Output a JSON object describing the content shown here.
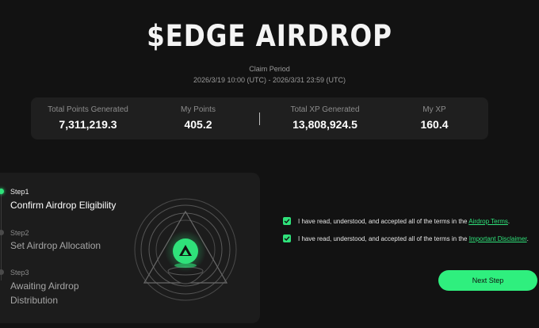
{
  "header": {
    "title": "$EDGE AIRDROP",
    "claim_label": "Claim Period",
    "claim_range": "2026/3/19 10:00 (UTC) - 2026/3/31 23:59 (UTC)"
  },
  "stats": [
    {
      "label": "Total Points Generated",
      "value": "7,311,219.3"
    },
    {
      "label": "My Points",
      "value": "405.2"
    },
    {
      "label": "Total XP Generated",
      "value": "13,808,924.5"
    },
    {
      "label": "My XP",
      "value": "160.4"
    }
  ],
  "steps": [
    {
      "num": "Step1",
      "title": "Confirm Airdrop Eligibility",
      "active": true
    },
    {
      "num": "Step2",
      "title": "Set Airdrop Allocation",
      "active": false
    },
    {
      "num": "Step3",
      "title": "Awaiting Airdrop Distribution",
      "active": false
    }
  ],
  "terms": [
    {
      "text": "I have read, understood, and accepted all of the terms in the ",
      "link": "Airdrop Terms",
      "suffix": ".",
      "checked": true
    },
    {
      "text": "I have read, understood, and accepted all of the terms in the ",
      "link": "Important Disclaimer",
      "suffix": ".",
      "checked": true
    }
  ],
  "next_button": "Next Step",
  "icons": {
    "check": "check-icon",
    "logo": "edge-logo-icon"
  },
  "colors": {
    "accent": "#2fe27a",
    "background": "#121212",
    "card": "#1f1f1f"
  }
}
